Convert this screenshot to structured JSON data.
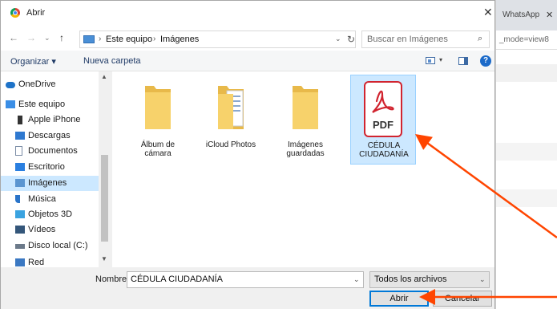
{
  "background_browser": {
    "tab_label": "WhatsApp",
    "tab_close": "✕",
    "url_text": "_mode=view8"
  },
  "dialog": {
    "title": "Abrir",
    "close_glyph": "✕",
    "nav": {
      "back_glyph": "←",
      "forward_glyph": "→",
      "recent_glyph": "⌄",
      "up_glyph": "↑"
    },
    "address": {
      "crumbs": [
        "Este equipo",
        "Imágenes"
      ],
      "separator": "›",
      "dropdown_glyph": "⌄",
      "refresh_glyph": "↻"
    },
    "search": {
      "placeholder": "Buscar en Imágenes",
      "icon_glyph": "⌕"
    },
    "toolbar": {
      "organize_label": "Organizar ▾",
      "new_folder_label": "Nueva carpeta",
      "view_caret": "▾",
      "help_glyph": "?"
    },
    "sidebar": {
      "items": [
        {
          "label": "OneDrive",
          "icon": "cloud-icon",
          "color": "#1e73c8",
          "selected": false
        },
        {
          "label": "Este equipo",
          "icon": "computer-icon",
          "color": "#3a8ee6",
          "selected": false
        },
        {
          "label": "Apple iPhone",
          "icon": "phone-icon",
          "color": "#333333",
          "selected": false
        },
        {
          "label": "Descargas",
          "icon": "download-icon",
          "color": "#2f79d0",
          "selected": false
        },
        {
          "label": "Documentos",
          "icon": "documents-icon",
          "color": "#7a8ca5",
          "selected": false
        },
        {
          "label": "Escritorio",
          "icon": "desktop-icon",
          "color": "#2a7fe0",
          "selected": false
        },
        {
          "label": "Imágenes",
          "icon": "pictures-icon",
          "color": "#5b95d0",
          "selected": true
        },
        {
          "label": "Música",
          "icon": "music-icon",
          "color": "#2a74c9",
          "selected": false
        },
        {
          "label": "Objetos 3D",
          "icon": "objects-3d-icon",
          "color": "#3aa3e0",
          "selected": false
        },
        {
          "label": "Vídeos",
          "icon": "videos-icon",
          "color": "#34567a",
          "selected": false
        },
        {
          "label": "Disco local (C:)",
          "icon": "drive-icon",
          "color": "#6c7a8a",
          "selected": false
        },
        {
          "label": "Red",
          "icon": "network-icon",
          "color": "#3b78c2",
          "selected": false
        }
      ],
      "scroll_up": "▲",
      "scroll_down": "▼"
    },
    "files": [
      {
        "label_line1": "Álbum de",
        "label_line2": "cámara",
        "type": "folder",
        "selected": false
      },
      {
        "label_line1": "iCloud Photos",
        "label_line2": "",
        "type": "folder-docs",
        "selected": false
      },
      {
        "label_line1": "Imágenes",
        "label_line2": "guardadas",
        "type": "folder",
        "selected": false
      },
      {
        "label_line1": "CÉDULA",
        "label_line2": "CIUDADANÍA",
        "type": "pdf",
        "selected": true,
        "badge": "PDF"
      }
    ],
    "bottom": {
      "name_label": "Nombre:",
      "name_value": "CÉDULA CIUDADANÍA",
      "name_dropdown": "⌄",
      "filter_value": "Todos los archivos",
      "filter_dropdown": "⌄",
      "open_label": "Abrir",
      "cancel_label": "Cancelar"
    }
  },
  "colors": {
    "selection": "#cce8ff",
    "folder": "#f7d26b",
    "pdf_red": "#d1242f",
    "arrow": "#ff4500"
  }
}
